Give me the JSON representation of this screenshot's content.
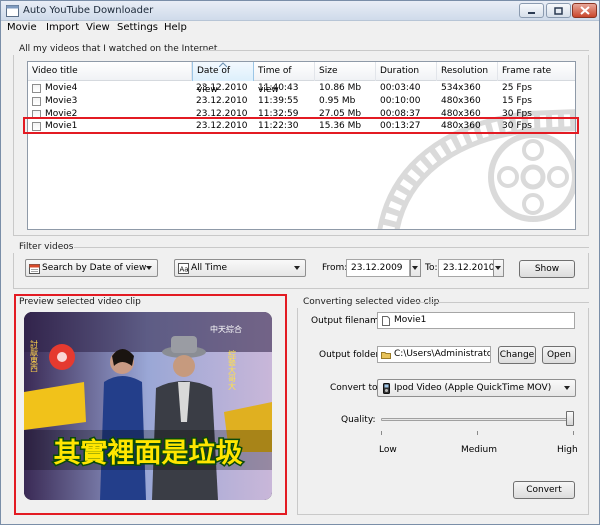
{
  "window": {
    "title": "Auto YouTube Downloader"
  },
  "menu": [
    "Movie",
    "Import",
    "View",
    "Settings",
    "Help"
  ],
  "videos": {
    "group_label": "All my videos that I watched on the Internet",
    "columns": [
      "Video title",
      "Date of view",
      "Time of view",
      "Size",
      "Duration",
      "Resolution",
      "Frame rate"
    ],
    "sorted_column": "Date of view",
    "rows": [
      {
        "title": "Movie4",
        "date": "23.12.2010",
        "time": "11:40:43",
        "size": "10.86 Mb",
        "duration": "00:03:40",
        "resolution": "534x360",
        "framerate": "25 Fps"
      },
      {
        "title": "Movie3",
        "date": "23.12.2010",
        "time": "11:39:55",
        "size": "0.95 Mb",
        "duration": "00:10:00",
        "resolution": "480x360",
        "framerate": "15 Fps"
      },
      {
        "title": "Movie2",
        "date": "23.12.2010",
        "time": "11:32:59",
        "size": "27.05 Mb",
        "duration": "00:08:37",
        "resolution": "480x360",
        "framerate": "30 Fps"
      },
      {
        "title": "Movie1",
        "date": "23.12.2010",
        "time": "11:22:30",
        "size": "15.36 Mb",
        "duration": "00:13:27",
        "resolution": "480x360",
        "framerate": "30 Fps"
      }
    ],
    "selected_row": 3
  },
  "filter": {
    "group_label": "Filter videos",
    "mode": "Search by Date of view",
    "period": "All Time",
    "from_label": "From:",
    "from_value": "23.12.2009",
    "to_label": "To:",
    "to_value": "23.12.2010",
    "show_button": "Show"
  },
  "preview": {
    "group_label": "Preview selected video clip",
    "caption_text": "其實裡面是垃圾",
    "channel_logo": "中天綜合",
    "side_text": "討厭東西",
    "side_banner": "綜藝大哥大"
  },
  "convert": {
    "group_label": "Converting selected video clip",
    "filename_label": "Output filename:",
    "filename_value": "Movie1",
    "folder_label": "Output folder:",
    "folder_value": "C:\\Users\\Administrator\\Wi",
    "change_button": "Change",
    "open_button": "Open",
    "convert_to_label": "Convert to:",
    "convert_to_value": "Ipod Video (Apple QuickTime MOV)",
    "quality_label": "Quality:",
    "quality_fraction": 1.0,
    "quality_marks": [
      "Low",
      "Medium",
      "High"
    ],
    "convert_button": "Convert"
  }
}
